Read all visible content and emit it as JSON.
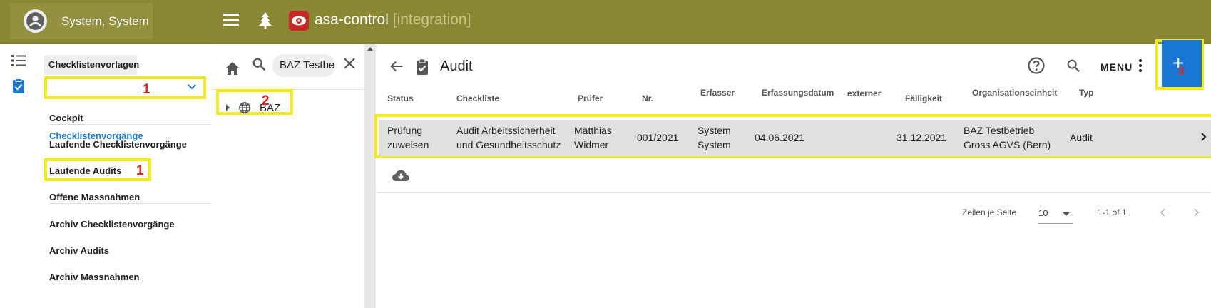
{
  "topbar": {
    "user_name": "System, System",
    "brand_name": "asa-control",
    "brand_env": "[integration]"
  },
  "sidebar": {
    "items": [
      {
        "label": "Checklistenvorlagen"
      },
      {
        "label": "Checklistenvorgänge"
      },
      {
        "label": "Cockpit"
      },
      {
        "label": "Laufende Checklistenvorgänge"
      },
      {
        "label": "Laufende Audits"
      },
      {
        "label": "Offene Massnahmen"
      },
      {
        "label": "Archiv Checklistenvorgänge"
      },
      {
        "label": "Archiv Audits"
      },
      {
        "label": "Archiv Massnahmen"
      }
    ],
    "markers": [
      "1",
      "1"
    ]
  },
  "tree": {
    "search_value": "BAZ Testbetrieb",
    "node_label": "BAZ",
    "marker": "2"
  },
  "main": {
    "title": "Audit",
    "menu_label": "MENU",
    "add_label": "+",
    "add_marker": "3",
    "columns": [
      "Status",
      "Checkliste",
      "Prüfer",
      "Nr.",
      "Erfasser",
      "Erfassungsdatum",
      "externer Prüfer",
      "Fälligkeit",
      "Organisationseinheit",
      "Typ"
    ],
    "row": {
      "status": [
        "Prüfung",
        "zuweisen"
      ],
      "checkliste": [
        "Audit Arbeitssicherheit",
        "und Gesundheitsschutz"
      ],
      "pruefer": [
        "Matthias",
        "Widmer"
      ],
      "nr": "001/2021",
      "erfasser": [
        "System",
        "System"
      ],
      "erfassungsdatum": "04.06.2021",
      "externer_pruefer": "",
      "faelligkeit": "31.12.2021",
      "organisationseinheit": [
        "BAZ Testbetrieb",
        "Gross AGVS (Bern)"
      ],
      "typ": "Audit"
    },
    "pager": {
      "rows_per_page_label": "Zeilen je Seite",
      "rows_per_page": "10",
      "range": "1-1 of 1"
    }
  },
  "colors": {
    "topbar": "#8a8734",
    "accent": "#1976d2",
    "highlight": "#f4ea1a",
    "marker": "#e1251b"
  },
  "icons": [
    "account-circle-icon",
    "hamburger-menu-icon",
    "tree-icon",
    "brand-logo-icon",
    "list-icon",
    "clipboard-check-icon",
    "home-icon",
    "search-icon",
    "close-icon",
    "globe-icon",
    "arrow-back-icon",
    "help-icon",
    "more-vert-icon",
    "cloud-download-icon",
    "chevron-right-icon"
  ]
}
